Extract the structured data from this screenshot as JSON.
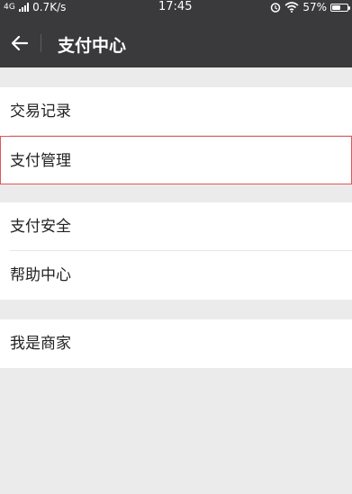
{
  "status_bar": {
    "network": "4G",
    "speed": "0.7K/s",
    "time": "17:45",
    "battery": "57%",
    "battery_level": 0.57
  },
  "header": {
    "title": "支付中心",
    "back_icon": "back-arrow-icon"
  },
  "menu": {
    "group1": [
      "交易记录",
      "支付管理"
    ],
    "group2": [
      "支付安全",
      "帮助中心"
    ],
    "group3": [
      "我是商家"
    ]
  },
  "colors": {
    "header_bg": "#3a3a3c",
    "page_bg": "#ebebeb",
    "highlight_border": "#e0565c"
  }
}
